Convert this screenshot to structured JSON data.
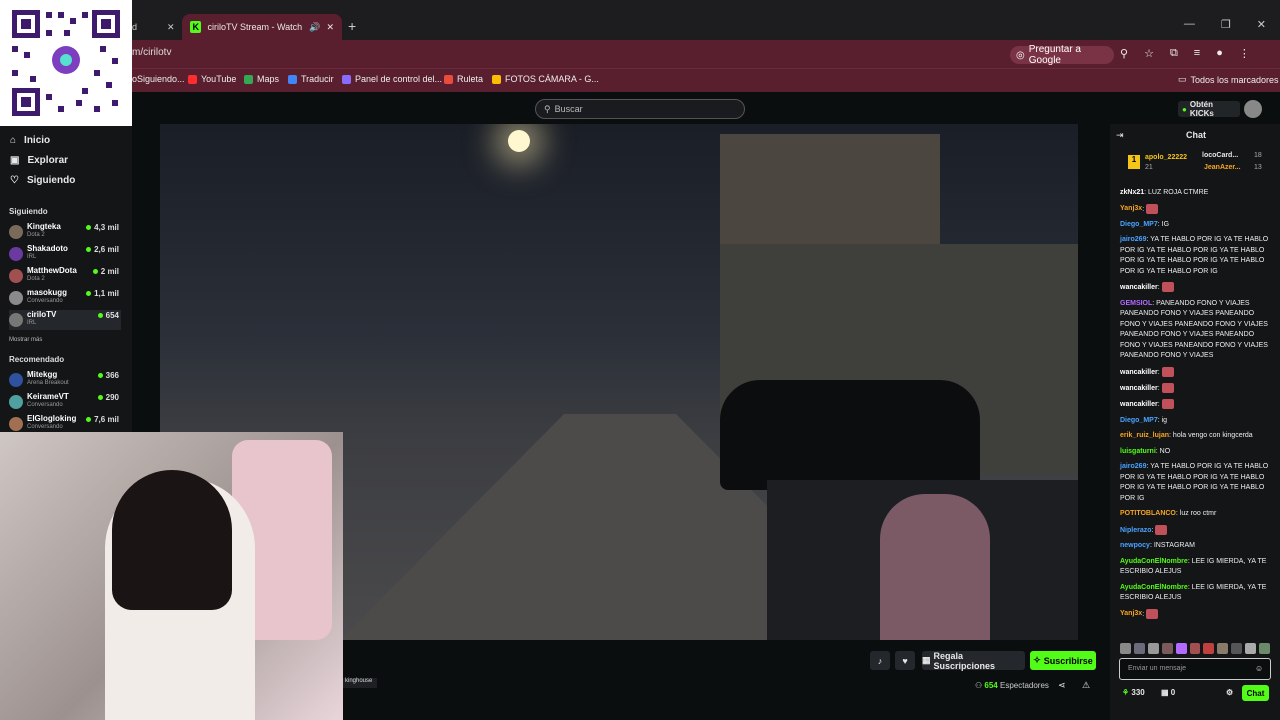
{
  "browser": {
    "prev_tab_title": "d",
    "active_tab_title": "ciriloTV Stream - Watch Liv",
    "url": "m/cirilotv",
    "ask_google": "Preguntar a Google",
    "bookmarks": [
      "oSiguiendo...",
      "YouTube",
      "Maps",
      "Traducir",
      "Panel de control del...",
      "Ruleta",
      "FOTOS CÁMARA - G..."
    ],
    "bookmark_colors": [
      "#888888",
      "#ff2d2d",
      "#34a853",
      "#4285f4",
      "#8a6bff",
      "#e94b3c",
      "#fbbc05"
    ],
    "all_bookmarks": "Todos los marcadores"
  },
  "header": {
    "search_placeholder": "Buscar",
    "get_kicks": "Obtén KICKs"
  },
  "sidebar": {
    "nav": [
      "Inicio",
      "Explorar",
      "Siguiendo"
    ],
    "following_title": "Siguiendo",
    "following": [
      {
        "name": "Kingteka",
        "sub": "Dota 2",
        "viewers": "4,3 mil",
        "color": "#7a6a5a"
      },
      {
        "name": "Shakadoto",
        "sub": "IRL",
        "viewers": "2,6 mil",
        "color": "#6a3aa0"
      },
      {
        "name": "MatthewDota",
        "sub": "Dota 2",
        "viewers": "2 mil",
        "color": "#a05050"
      },
      {
        "name": "masokugg",
        "sub": "Conversando",
        "viewers": "1,1 mil",
        "color": "#8a8a8a"
      },
      {
        "name": "ciriloTV",
        "sub": "IRL",
        "viewers": "654",
        "color": "#777777"
      }
    ],
    "show_more": "Mostrar más",
    "recommended_title": "Recomendado",
    "recommended": [
      {
        "name": "Mitekgg",
        "sub": "Arena Breakout",
        "viewers": "366",
        "color": "#3050a0"
      },
      {
        "name": "KeirameVT",
        "sub": "Conversando",
        "viewers": "290",
        "color": "#50a0a0"
      },
      {
        "name": "ElGlogloking",
        "sub": "Conversando",
        "viewers": "7,6 mil",
        "color": "#a07050"
      }
    ]
  },
  "stream": {
    "tag": "kinghouse",
    "gift_subs": "Regala Suscripciones",
    "subscribe": "Suscribirse",
    "viewers_count": "654",
    "viewers_label": "Espectadores"
  },
  "chat": {
    "title": "Chat",
    "leaderboard": [
      {
        "name": "apolo_22222",
        "count": "21"
      },
      {
        "name": "locoCard...",
        "count": "18"
      },
      {
        "name": "JeanAzer...",
        "count": "13"
      }
    ],
    "messages": [
      {
        "user": "zkNx21",
        "color": "#ffffff",
        "text": "LUZ ROJA CTMRE"
      },
      {
        "user": "Yanj3x",
        "color": "#f5a623",
        "text": ""
      },
      {
        "user": "Diego_MP7",
        "color": "#4aa3ff",
        "text": "IG"
      },
      {
        "user": "jairo269",
        "color": "#4aa3ff",
        "text": "YA TE HABLO POR IG YA TE HABLO POR IG YA TE HABLO POR IG YA TE HABLO POR IG YA TE HABLO POR IG YA TE HABLO POR IG YA TE HABLO POR IG"
      },
      {
        "user": "wancakiller",
        "color": "#ffffff",
        "text": ""
      },
      {
        "user": "GEMSIOL",
        "color": "#b36bff",
        "text": "PANEANDO FONO Y VIAJES PANEANDO FONO Y VIAJES PANEANDO FONO Y VIAJES PANEANDO FONO Y VIAJES PANEANDO FONO Y VIAJES PANEANDO FONO Y VIAJES PANEANDO FONO Y VIAJES PANEANDO FONO Y VIAJES"
      },
      {
        "user": "wancakiller",
        "color": "#ffffff",
        "text": ""
      },
      {
        "user": "wancakiller",
        "color": "#ffffff",
        "text": ""
      },
      {
        "user": "wancakiller",
        "color": "#ffffff",
        "text": ""
      },
      {
        "user": "Diego_MP7",
        "color": "#4aa3ff",
        "text": "ig"
      },
      {
        "user": "erik_ruiz_lujan",
        "color": "#f5a623",
        "text": "hola vengo con kingcerda"
      },
      {
        "user": "luisgaturni",
        "color": "#53fc18",
        "text": "NO"
      },
      {
        "user": "jairo269",
        "color": "#4aa3ff",
        "text": "YA TE HABLO POR IG YA TE HABLO POR IG YA TE HABLO POR IG YA TE HABLO POR IG YA TE HABLO POR IG YA TE HABLO POR IG"
      },
      {
        "user": "POTITOBLANCO",
        "color": "#f5a623",
        "text": "luz roo ctmr"
      },
      {
        "user": "Niplerazo",
        "color": "#4aa3ff",
        "text": ""
      },
      {
        "user": "newpocy",
        "color": "#4aa3ff",
        "text": "INSTAGRAM"
      },
      {
        "user": "AyudaConElNombre",
        "color": "#53fc18",
        "text": "LEE IG MIERDA, YA TE ESCRIBIO ALEJUS"
      },
      {
        "user": "AyudaConElNombre",
        "color": "#53fc18",
        "text": "LEE IG MIERDA, YA TE ESCRIBIO ALEJUS"
      },
      {
        "user": "Yanj3x",
        "color": "#f5a623",
        "text": ""
      }
    ],
    "input_placeholder": "Enviar un mensaje",
    "points": "330",
    "gifts": "0",
    "send_label": "Chat"
  }
}
